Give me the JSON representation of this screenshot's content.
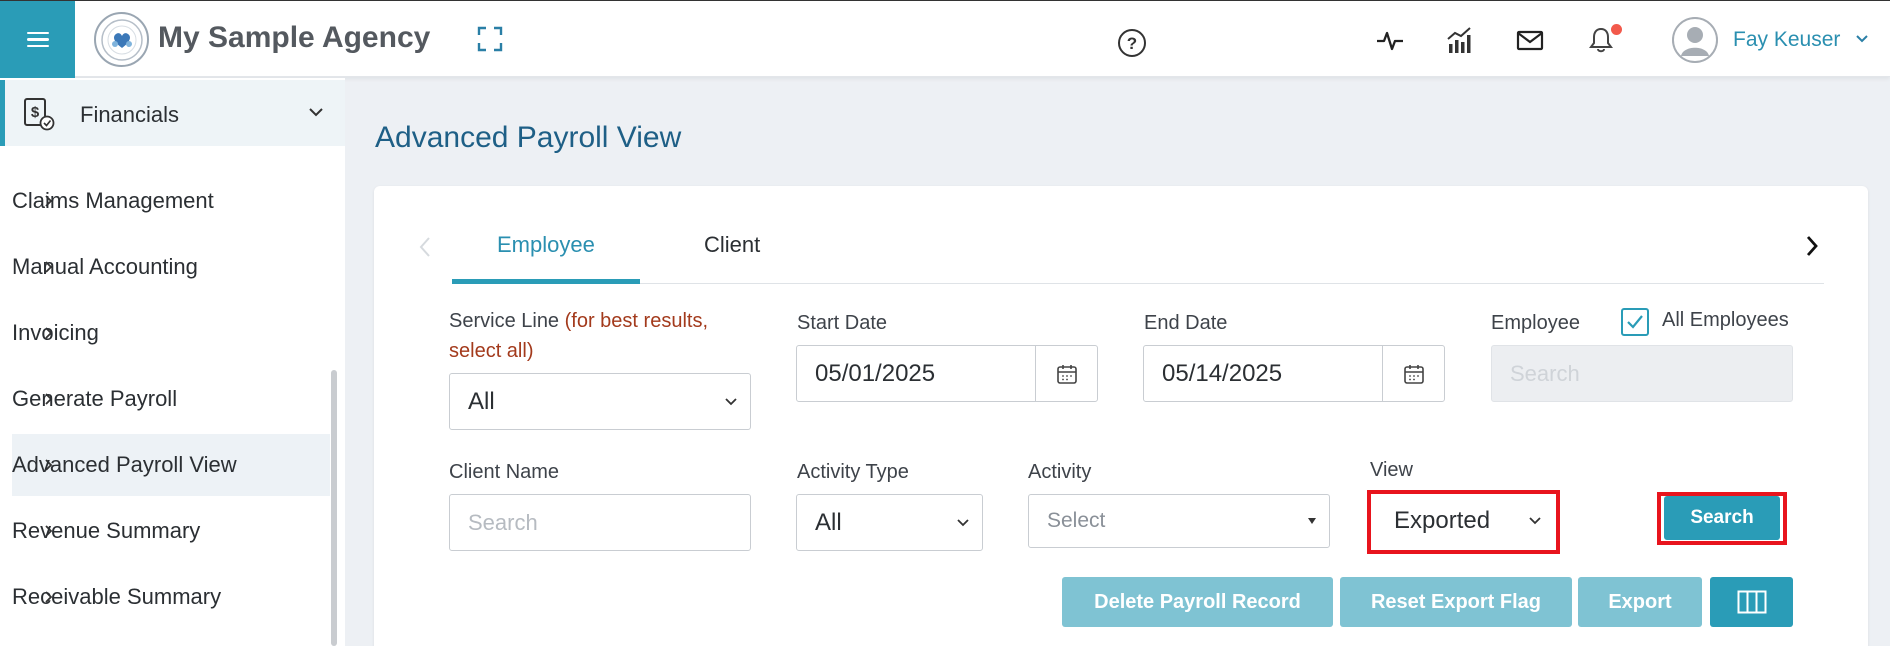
{
  "header": {
    "brand": "My Sample Agency",
    "user_name": "Fay Keuser"
  },
  "sidebar": {
    "section": "Financials",
    "items": [
      {
        "label": "Claims Management"
      },
      {
        "label": "Manual Accounting"
      },
      {
        "label": "Invoicing"
      },
      {
        "label": "Generate Payroll"
      },
      {
        "label": "Advanced Payroll View"
      },
      {
        "label": "Revenue Summary"
      },
      {
        "label": "Receivable Summary"
      }
    ]
  },
  "main": {
    "title": "Advanced Payroll View",
    "tabs": [
      {
        "label": "Employee"
      },
      {
        "label": "Client"
      }
    ],
    "filters": {
      "service_line_label": "Service Line",
      "service_line_hint_1": "(for best results,",
      "service_line_hint_2": "select all)",
      "service_line_value": "All",
      "start_date_label": "Start Date",
      "start_date_value": "05/01/2025",
      "end_date_label": "End Date",
      "end_date_value": "05/14/2025",
      "employee_label": "Employee",
      "all_employees_label": "All Employees",
      "employee_placeholder": "Search",
      "client_name_label": "Client Name",
      "client_name_placeholder": "Search",
      "activity_type_label": "Activity Type",
      "activity_type_value": "All",
      "activity_label": "Activity",
      "activity_placeholder": "Select",
      "view_label": "View",
      "view_value": "Exported"
    },
    "buttons": {
      "search": "Search",
      "delete_payroll": "Delete Payroll Record",
      "reset_export": "Reset Export Flag",
      "export": "Export"
    }
  },
  "colors": {
    "accent": "#2a9cb7",
    "title": "#1e5f86",
    "highlight": "#e8141d",
    "warn_text": "#a33a1c"
  }
}
